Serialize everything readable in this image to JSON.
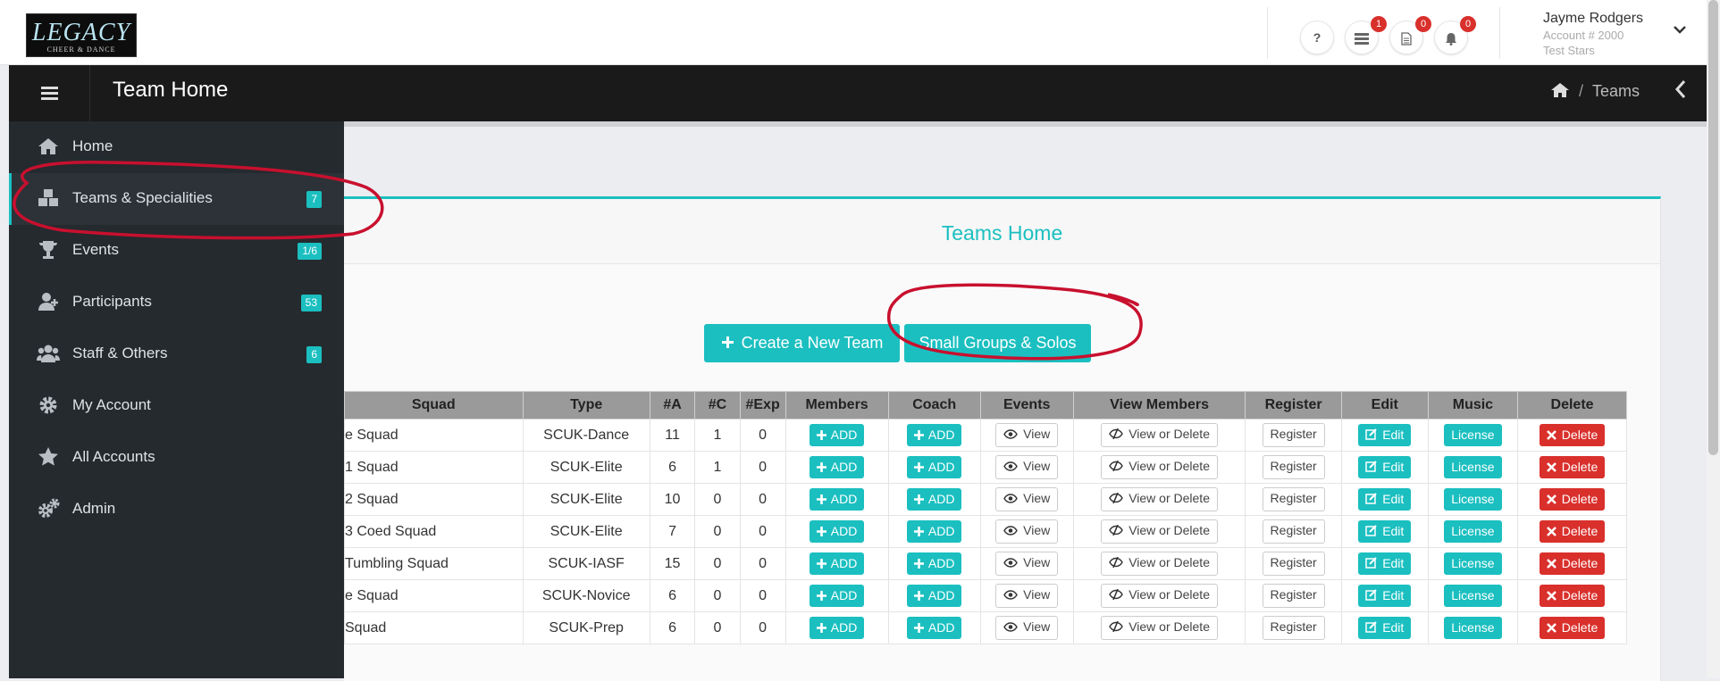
{
  "logo": {
    "text": "LEGACY",
    "sub": "CHEER & DANCE"
  },
  "topbar": {
    "help_label": "?",
    "badges": {
      "list": "1",
      "doc": "0",
      "bell": "0"
    },
    "user_name": "Jayme Rodgers",
    "account": "Account # 2000",
    "org": "Test Stars"
  },
  "header": {
    "title": "Team Home",
    "breadcrumb": "Teams"
  },
  "sidebar": {
    "items": [
      {
        "label": "Home",
        "badge": ""
      },
      {
        "label": "Teams & Specialities",
        "badge": "7"
      },
      {
        "label": "Events",
        "badge": "1/6"
      },
      {
        "label": "Participants",
        "badge": "53"
      },
      {
        "label": "Staff & Others",
        "badge": "6"
      },
      {
        "label": "My Account",
        "badge": ""
      },
      {
        "label": "All Accounts",
        "badge": ""
      },
      {
        "label": "Admin",
        "badge": ""
      }
    ]
  },
  "panel": {
    "title": "Teams Home",
    "create_label": "Create a New Team",
    "groups_label": "Small Groups & Solos"
  },
  "table": {
    "headers": [
      "Squad",
      "Type",
      "#A",
      "#C",
      "#Exp",
      "Members",
      "Coach",
      "Events",
      "View Members",
      "Register",
      "Edit",
      "Music",
      "Delete"
    ],
    "rows": [
      {
        "squad": "e Squad",
        "type": "SCUK-Dance",
        "a": "11",
        "c": "1",
        "exp": "0"
      },
      {
        "squad": "1 Squad",
        "type": "SCUK-Elite",
        "a": "6",
        "c": "1",
        "exp": "0"
      },
      {
        "squad": "2 Squad",
        "type": "SCUK-Elite",
        "a": "10",
        "c": "0",
        "exp": "0"
      },
      {
        "squad": "3 Coed Squad",
        "type": "SCUK-Elite",
        "a": "7",
        "c": "0",
        "exp": "0"
      },
      {
        "squad": "Tumbling Squad",
        "type": "SCUK-IASF",
        "a": "15",
        "c": "0",
        "exp": "0"
      },
      {
        "squad": "e Squad",
        "type": "SCUK-Novice",
        "a": "6",
        "c": "0",
        "exp": "0"
      },
      {
        "squad": "Squad",
        "type": "SCUK-Prep",
        "a": "6",
        "c": "0",
        "exp": "0"
      }
    ],
    "button_labels": {
      "add": "ADD",
      "view": "View",
      "view_delete": "View or Delete",
      "register": "Register",
      "edit": "Edit",
      "license": "License",
      "delete": "Delete"
    }
  },
  "colors": {
    "accent": "#1bbfc0",
    "danger": "#d9302c",
    "sidebar": "#252a2e",
    "header": "#1a1a1a",
    "annotation": "#c8102e"
  }
}
